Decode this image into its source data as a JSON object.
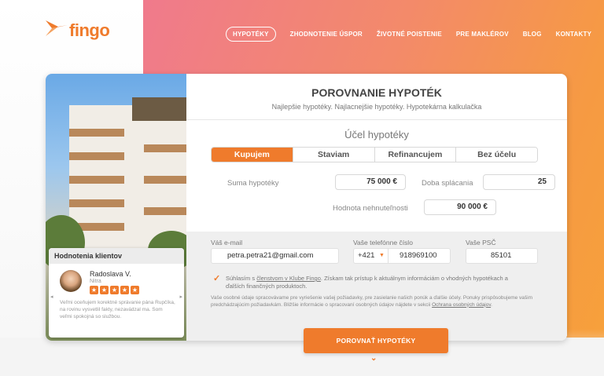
{
  "brand": {
    "name": "fingo",
    "accent": "#ef7b2c"
  },
  "nav": [
    {
      "label": "HYPOTÉKY",
      "active": true
    },
    {
      "label": "ZHODNOTENIE ÚSPOR"
    },
    {
      "label": "ŽIVOTNÉ POISTENIE"
    },
    {
      "label": "PRE MAKLÉROV"
    },
    {
      "label": "BLOG"
    },
    {
      "label": "KONTAKTY"
    }
  ],
  "review": {
    "heading": "Hodnotenia klientov",
    "name": "Radoslava V.",
    "city": "Nitra",
    "rating": 5,
    "text": "Veľmi oceňujem korektné správanie pána Rupčíka, na rovinu vysvetlil fakty, nezavádzal ma. Som veľmi spokojná so službou."
  },
  "form": {
    "title": "POROVNANIE HYPOTÉK",
    "subtitle": "Najlepšie hypotéky. Najlacnejšie hypotéky. Hypotekárna kalkulačka",
    "purpose_label": "Účel hypotéky",
    "purpose_tabs": [
      "Kupujem",
      "Staviam",
      "Refinancujem",
      "Bez účelu"
    ],
    "loan_label": "Suma hypotéky",
    "loan_value": "75 000 €",
    "term_label": "Doba splácania",
    "term_value": "25",
    "property_label": "Hodnota nehnuteľnosti",
    "property_value": "90 000 €",
    "email_label": "Váš e-mail",
    "email_value": "petra.petra21@gmail.com",
    "phone_label": "Vaše telefónne číslo",
    "phone_prefix": "+421",
    "phone_value": "918969100",
    "zip_label": "Vaše PSČ",
    "zip_value": "85101",
    "consent_pre": "Súhlasím s ",
    "consent_link": "členstvom v Klube Fingo",
    "consent_post": ". Získam tak prístup k aktuálnym informáciám o vhodných hypotékach a ďalších finančných produktoch.",
    "privacy_pre": "Vaše osobné údaje spracovávame pre vyriešenie vašej požiadavky, pre zasielanie našich ponúk a ďalšie účely. Ponuky prispôsobujeme vašim predchádzajúcim požiadavkám. Bližšie informácie o spracovaní osobných údajov nájdete v sekcii ",
    "privacy_link": "Ochrana osobných údajov",
    "privacy_post": ".",
    "submit_label": "POROVNAŤ HYPOTÉKY"
  }
}
